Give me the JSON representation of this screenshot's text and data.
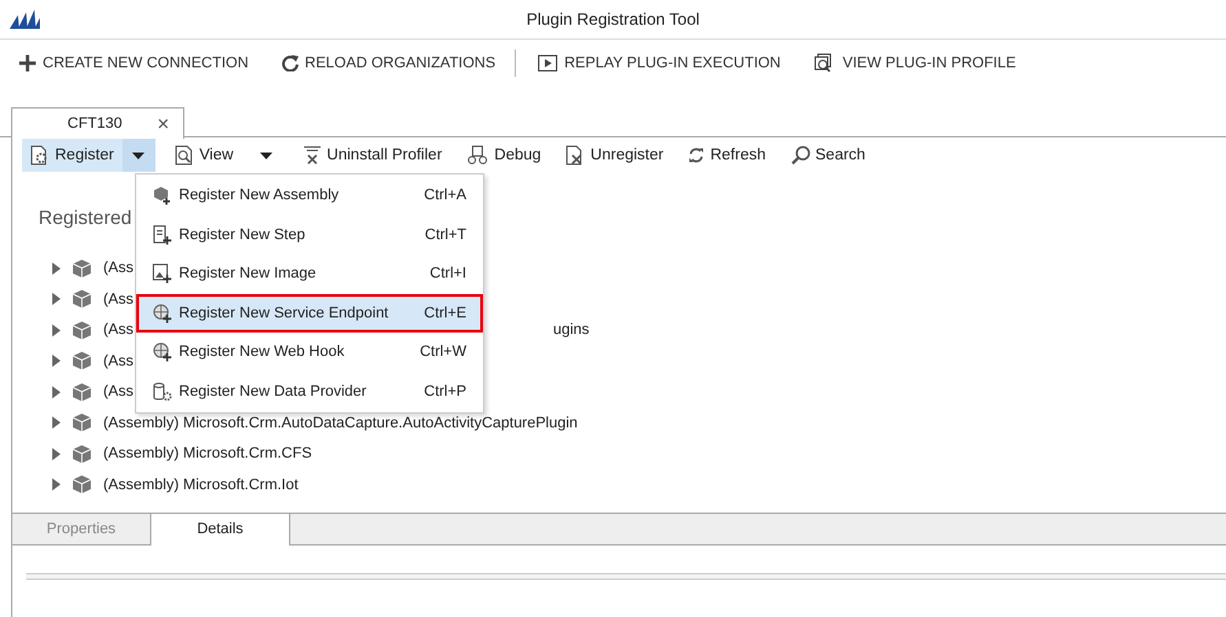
{
  "window": {
    "title": "Plugin Registration Tool"
  },
  "toolbar": [
    {
      "label": "CREATE NEW CONNECTION",
      "kind": "plus"
    },
    {
      "label": "RELOAD ORGANIZATIONS",
      "kind": "reload"
    },
    {
      "label": "REPLAY PLUG-IN EXECUTION",
      "kind": "replay"
    },
    {
      "label": "VIEW PLUG-IN PROFILE",
      "kind": "profile"
    }
  ],
  "tabs": [
    {
      "label": "CFT130",
      "close": "×",
      "selected": true
    }
  ],
  "commands": [
    {
      "label": "Register",
      "kind": "register",
      "dropdown": true,
      "selected": true
    },
    {
      "label": "View",
      "kind": "view",
      "dropdown": true,
      "selected": false
    },
    {
      "label": "Uninstall Profiler",
      "kind": "uninstall",
      "dropdown": false,
      "selected": false
    },
    {
      "label": "Debug",
      "kind": "debug",
      "dropdown": false,
      "selected": false
    },
    {
      "label": "Unregister",
      "kind": "unregister",
      "dropdown": false,
      "selected": false
    },
    {
      "label": "Refresh",
      "kind": "refresh",
      "dropdown": false,
      "selected": false
    },
    {
      "label": "Search",
      "kind": "search",
      "dropdown": false,
      "selected": false
    }
  ],
  "menu": [
    {
      "label": "Register New Assembly",
      "shortcut": "Ctrl+A",
      "kind": "assembly",
      "selected": false
    },
    {
      "label": "Register New Step",
      "shortcut": "Ctrl+T",
      "kind": "step",
      "selected": false
    },
    {
      "label": "Register New Image",
      "shortcut": "Ctrl+I",
      "kind": "image",
      "selected": false
    },
    {
      "label": "Register New Service Endpoint",
      "shortcut": "Ctrl+E",
      "kind": "globe",
      "selected": true
    },
    {
      "label": "Register New Web Hook",
      "shortcut": "Ctrl+W",
      "kind": "globe",
      "selected": false
    },
    {
      "label": "Register New Data Provider",
      "shortcut": "Ctrl+P",
      "kind": "data",
      "selected": false
    }
  ],
  "heading": "Registered",
  "tree": [
    {
      "label": "(Ass",
      "expanded": false
    },
    {
      "label": "(Ass",
      "expanded": false
    },
    {
      "label": "(Ass",
      "tail": "ugins",
      "expanded": false
    },
    {
      "label": "(Ass",
      "expanded": false
    },
    {
      "label": "(Ass",
      "expanded": false
    },
    {
      "label": "(Assembly) Microsoft.Crm.AutoDataCapture.AutoActivityCapturePlugin",
      "expanded": false
    },
    {
      "label": "(Assembly) Microsoft.Crm.CFS",
      "expanded": false
    },
    {
      "label": "(Assembly) Microsoft.Crm.Iot",
      "expanded": false
    }
  ],
  "bottom_tabs": [
    {
      "label": "Properties",
      "selected": false
    },
    {
      "label": "Details",
      "selected": true
    }
  ]
}
